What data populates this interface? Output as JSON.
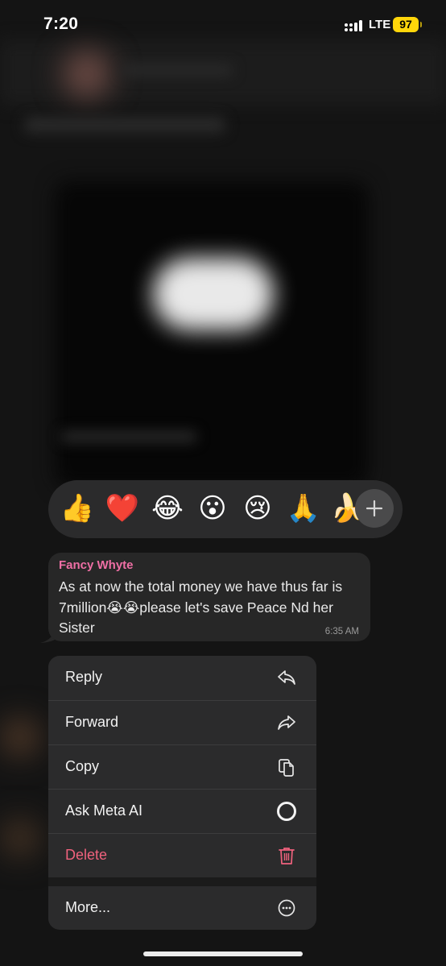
{
  "status": {
    "time": "7:20",
    "network": "LTE",
    "battery": "97"
  },
  "reactions": {
    "emojis": [
      "👍",
      "❤️",
      "😂",
      "😮",
      "😢",
      "🙏",
      "🍌"
    ],
    "more_symbol": "+"
  },
  "message": {
    "sender": "Fancy Whyte",
    "text": "As at now the total money we have thus far is 7million😭😭please let's save Peace Nd her Sister",
    "time": "6:35 AM"
  },
  "menu": {
    "items": [
      {
        "label": "Reply",
        "icon": "reply-icon"
      },
      {
        "label": "Forward",
        "icon": "forward-icon"
      },
      {
        "label": "Copy",
        "icon": "copy-icon"
      },
      {
        "label": "Ask Meta AI",
        "icon": "meta-ai-icon"
      },
      {
        "label": "Delete",
        "icon": "trash-icon"
      },
      {
        "label": "More...",
        "icon": "more-icon"
      }
    ]
  },
  "colors": {
    "sender": "#ef6fa5",
    "delete": "#f0627d",
    "battery": "#ffd60a"
  }
}
